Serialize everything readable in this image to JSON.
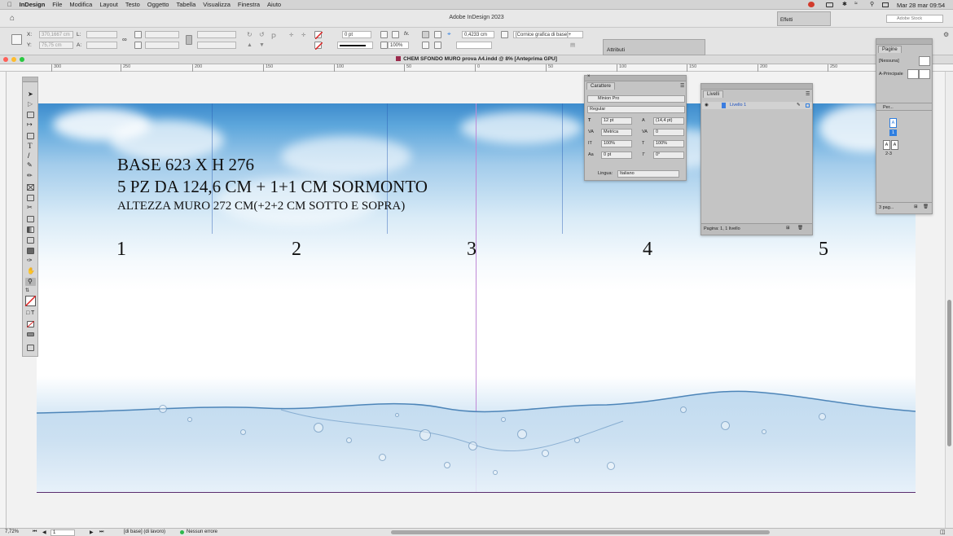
{
  "menubar": {
    "app_name": "InDesign",
    "items": [
      "File",
      "Modifica",
      "Layout",
      "Testo",
      "Oggetto",
      "Tabella",
      "Visualizza",
      "Finestra",
      "Aiuto"
    ],
    "clock": "Mar 28 mar  09:54"
  },
  "window": {
    "title": "Adobe InDesign 2023",
    "stock_search": "Adobe Stock"
  },
  "control": {
    "x_label": "X:",
    "x_value": "370,1667 cm",
    "y_label": "Y:",
    "y_value": "75,75 cm",
    "w_label": "L:",
    "h_label": "A:",
    "stroke_weight": "0 pt",
    "opacity": "100%",
    "dimension": "0,4233 cm",
    "object_style": "[Cornice grafica di base]+"
  },
  "document": {
    "tab_title": "CHEM SFONDO MURO prova A4.indd @ 8% [Anteprima GPU]"
  },
  "ruler": {
    "labels": [
      "300",
      "250",
      "200",
      "150",
      "100",
      "50",
      "0",
      "50",
      "100",
      "150",
      "200",
      "250"
    ]
  },
  "page_text": {
    "line1": "BASE 623 X H 276",
    "line2": "5 PZ DA 124,6 CM + 1+1 CM SORMONTO",
    "line3": "ALTEZZA MURO 272 CM(+2+2 CM SOTTO E SOPRA)",
    "numbers": [
      "1",
      "2",
      "3",
      "4",
      "5"
    ]
  },
  "effects_panel": {
    "tab": "Effetti"
  },
  "attributes_panel": {
    "tab": "Attributi"
  },
  "character_panel": {
    "tab": "Carattere",
    "font_family": "Minion Pro",
    "font_style": "Regular",
    "size": "12 pt",
    "leading": "(14,4 pt)",
    "kerning": "Metrica",
    "tracking": "0",
    "vscale": "100%",
    "hscale": "100%",
    "baseline": "0 pt",
    "skew": "0°",
    "language_label": "Lingua:",
    "language": "Italiano"
  },
  "layers_panel": {
    "tab": "Livelli",
    "layer_name": "Livello 1",
    "footer": "Pagina: 1, 1 livello"
  },
  "pages_panel": {
    "tab": "Pagine",
    "master_none": "[Nessuna]",
    "master_a": "A-Principale",
    "size_label": "Per...",
    "page_marker": "A",
    "page_number": "1",
    "spread_label": "2-3",
    "footer": "3 pag..."
  },
  "statusbar": {
    "zoom": "7,72%",
    "page": "1",
    "workspace": "[di base] (di lavoro)",
    "preflight": "Nessun errore"
  },
  "colors": {
    "preflight_ok": "#2db84d",
    "guide": "#c089d6",
    "accent": "#2f7fe0"
  }
}
